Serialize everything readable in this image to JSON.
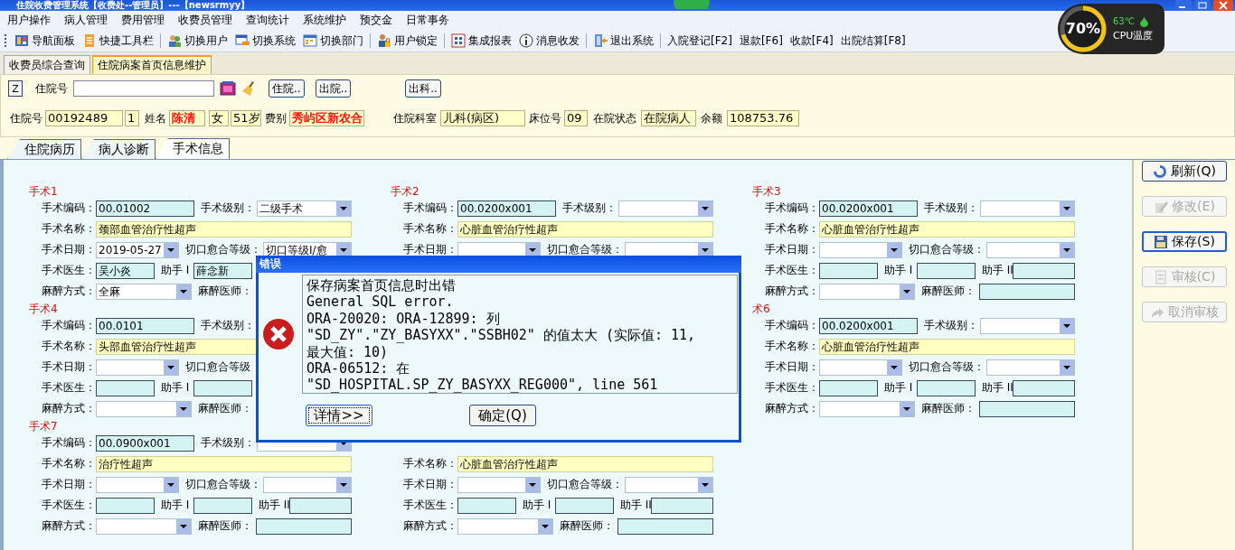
{
  "window": {
    "title": "住院收费管理系统【收费处--管理员】---【newsrmyy】"
  },
  "menu": [
    "用户操作",
    "病人管理",
    "费用管理",
    "收费员管理",
    "查询统计",
    "系统维护",
    "预交金",
    "日常事务"
  ],
  "toolbar": [
    [
      {
        "kind": "icon-button",
        "label": "导航面板"
      },
      {
        "kind": "icon-button",
        "label": "快捷工具栏"
      }
    ],
    [
      {
        "kind": "icon-button",
        "label": "切换用户"
      },
      {
        "kind": "icon-button",
        "label": "切换系统"
      },
      {
        "kind": "icon-button",
        "label": "切换部门"
      }
    ],
    [
      {
        "kind": "icon-button",
        "label": "用户锁定"
      }
    ],
    [
      {
        "kind": "icon-button",
        "label": "集成报表"
      },
      {
        "kind": "icon-button",
        "label": "消息收发"
      }
    ],
    [
      {
        "kind": "icon-button",
        "label": "退出系统"
      }
    ],
    [
      {
        "kind": "text-button",
        "label": "入院登记[F2]"
      },
      {
        "kind": "text-button",
        "label": "退款[F6]"
      },
      {
        "kind": "text-button",
        "label": "收款[F4]"
      },
      {
        "kind": "text-button",
        "label": "出院结算[F8]"
      }
    ]
  ],
  "cpu_widget": {
    "reading": "70%",
    "level": 0.7,
    "temperature": "63℃",
    "label": "CPU温度"
  },
  "tabs": [
    {
      "label": "收费员综合查询",
      "selected": false
    },
    {
      "label": "住院病案首页信息维护",
      "selected": true
    }
  ],
  "search": {
    "key_button": "Z",
    "label": "住院号",
    "buttons": [
      "住院..",
      "出院..",
      "出科.."
    ]
  },
  "patient_info": [
    {
      "kind": "label",
      "text": "住院号"
    },
    {
      "kind": "field",
      "value": "00192489"
    },
    {
      "kind": "field",
      "value": "1"
    },
    {
      "kind": "label",
      "text": "姓名"
    },
    {
      "kind": "field",
      "value": "陈清",
      "color": "#ff0000"
    },
    {
      "kind": "field",
      "value": "女"
    },
    {
      "kind": "field",
      "value": "51岁"
    },
    {
      "kind": "label",
      "text": "费别"
    },
    {
      "kind": "field",
      "value": "秀屿区新农合",
      "color": "#ff0000"
    },
    {
      "kind": "label",
      "text": "住院科室"
    },
    {
      "kind": "field",
      "value": "儿科(病区)"
    },
    {
      "kind": "label",
      "text": "床位号"
    },
    {
      "kind": "field",
      "value": "09"
    },
    {
      "kind": "label",
      "text": "在院状态"
    },
    {
      "kind": "field",
      "value": "在院病人"
    },
    {
      "kind": "label",
      "text": "余额"
    },
    {
      "kind": "field",
      "value": "108753.76"
    }
  ],
  "record_tabs": [
    {
      "label": "住院病历",
      "selected": false
    },
    {
      "label": "病人诊断",
      "selected": false
    },
    {
      "label": "手术信息",
      "selected": true
    }
  ],
  "surgeries": [
    {
      "title": "手术1",
      "rows": [
        {
          "kind": "code",
          "items": [
            {
              "kind": "label",
              "text": "手术编码："
            },
            {
              "kind": "field",
              "value": "00.01002"
            },
            {
              "kind": "label",
              "text": "手术级别："
            },
            {
              "kind": "select",
              "value": "二级手术"
            }
          ]
        },
        {
          "kind": "name",
          "items": [
            {
              "kind": "label",
              "text": "手术名称："
            },
            {
              "kind": "name-field",
              "value": "颈部血管治疗性超声"
            }
          ]
        },
        {
          "kind": "date",
          "items": [
            {
              "kind": "label",
              "text": "手术日期："
            },
            {
              "kind": "select",
              "value": "2019-05-27"
            },
            {
              "kind": "label",
              "text": "切口愈合等级："
            },
            {
              "kind": "select",
              "value": "切口等级Ⅰ/愈"
            }
          ]
        },
        {
          "kind": "staff",
          "items": [
            {
              "kind": "label",
              "text": "手术医生："
            },
            {
              "kind": "field",
              "value": "吴小炎"
            },
            {
              "kind": "label",
              "text": "助手 I"
            },
            {
              "kind": "field",
              "value": "薛念新"
            }
          ]
        },
        {
          "kind": "anesthesia",
          "items": [
            {
              "kind": "label",
              "text": "麻醉方式："
            },
            {
              "kind": "select",
              "value": "全麻"
            },
            {
              "kind": "label",
              "text": "麻醉医师："
            }
          ]
        }
      ]
    },
    {
      "title": "手术2",
      "rows": [
        {
          "kind": "code",
          "items": [
            {
              "kind": "label",
              "text": "手术编码："
            },
            {
              "kind": "field",
              "value": "00.0200x001"
            },
            {
              "kind": "label",
              "text": "手术级别："
            },
            {
              "kind": "select"
            }
          ]
        },
        {
          "kind": "name",
          "items": [
            {
              "kind": "label",
              "text": "手术名称："
            },
            {
              "kind": "name-field",
              "value": "心脏血管治疗性超声"
            }
          ]
        },
        {
          "kind": "date",
          "items": [
            {
              "kind": "label",
              "text": "手术日期："
            },
            {
              "kind": "select"
            },
            {
              "kind": "label",
              "text": "切口愈合等级："
            },
            {
              "kind": "select"
            }
          ]
        }
      ]
    },
    {
      "title": "手术3",
      "rows": [
        {
          "kind": "code",
          "items": [
            {
              "kind": "label",
              "text": "手术编码："
            },
            {
              "kind": "field",
              "value": "00.0200x001"
            },
            {
              "kind": "label",
              "text": "手术级别："
            },
            {
              "kind": "select"
            }
          ]
        },
        {
          "kind": "name",
          "items": [
            {
              "kind": "label",
              "text": "手术名称："
            },
            {
              "kind": "name-field",
              "value": "心脏血管治疗性超声"
            }
          ]
        },
        {
          "kind": "date",
          "items": [
            {
              "kind": "label",
              "text": "手术日期："
            },
            {
              "kind": "select"
            },
            {
              "kind": "label",
              "text": "切口愈合等级："
            },
            {
              "kind": "select"
            }
          ]
        },
        {
          "kind": "staff",
          "items": [
            {
              "kind": "label",
              "text": "手术医生："
            },
            {
              "kind": "field"
            },
            {
              "kind": "label",
              "text": "助手 I"
            },
            {
              "kind": "field"
            },
            {
              "kind": "label",
              "text": "助手 II"
            },
            {
              "kind": "field"
            }
          ]
        },
        {
          "kind": "anesthesia",
          "items": [
            {
              "kind": "label",
              "text": "麻醉方式："
            },
            {
              "kind": "select"
            },
            {
              "kind": "label",
              "text": "麻醉医师："
            },
            {
              "kind": "field"
            }
          ]
        }
      ]
    },
    {
      "title": "手术4",
      "rows": [
        {
          "kind": "code",
          "items": [
            {
              "kind": "label",
              "text": "手术编码："
            },
            {
              "kind": "field",
              "value": "00.0101"
            },
            {
              "kind": "label",
              "text": "手术级别："
            }
          ]
        },
        {
          "kind": "name",
          "items": [
            {
              "kind": "label",
              "text": "手术名称："
            },
            {
              "kind": "name-field",
              "value": "头部血管治疗性超声"
            }
          ]
        },
        {
          "kind": "date",
          "items": [
            {
              "kind": "label",
              "text": "手术日期："
            },
            {
              "kind": "select"
            },
            {
              "kind": "label",
              "text": "切口愈合等级"
            }
          ]
        },
        {
          "kind": "staff",
          "items": [
            {
              "kind": "label",
              "text": "手术医生："
            },
            {
              "kind": "field"
            },
            {
              "kind": "label",
              "text": "助手 I"
            },
            {
              "kind": "field"
            }
          ]
        },
        {
          "kind": "anesthesia",
          "items": [
            {
              "kind": "label",
              "text": "麻醉方式："
            },
            {
              "kind": "select"
            },
            {
              "kind": "label",
              "text": "麻醉医师："
            }
          ]
        }
      ]
    },
    {
      "title": "术6",
      "rows": [
        {
          "kind": "code",
          "items": [
            {
              "kind": "label",
              "text": "手术编码："
            },
            {
              "kind": "field",
              "value": "00.0200x001"
            },
            {
              "kind": "label",
              "text": "手术级别："
            },
            {
              "kind": "select"
            }
          ]
        },
        {
          "kind": "name",
          "items": [
            {
              "kind": "label",
              "text": "手术名称："
            },
            {
              "kind": "name-field",
              "value": "心脏血管治疗性超声"
            }
          ]
        },
        {
          "kind": "date",
          "items": [
            {
              "kind": "label",
              "text": "手术日期："
            },
            {
              "kind": "select"
            },
            {
              "kind": "label",
              "text": "切口愈合等级："
            },
            {
              "kind": "select"
            }
          ]
        },
        {
          "kind": "staff",
          "items": [
            {
              "kind": "label",
              "text": "手术医生："
            },
            {
              "kind": "field"
            },
            {
              "kind": "label",
              "text": "助手 I"
            },
            {
              "kind": "field"
            },
            {
              "kind": "label",
              "text": "助手 II"
            },
            {
              "kind": "field"
            }
          ]
        },
        {
          "kind": "anesthesia",
          "items": [
            {
              "kind": "label",
              "text": "麻醉方式："
            },
            {
              "kind": "select"
            },
            {
              "kind": "label",
              "text": "麻醉医师："
            },
            {
              "kind": "field"
            }
          ]
        }
      ]
    },
    {
      "title": "手术7",
      "rows": [
        {
          "kind": "code",
          "items": [
            {
              "kind": "label",
              "text": "手术编码："
            },
            {
              "kind": "field",
              "value": "00.0900x001"
            },
            {
              "kind": "label",
              "text": "手术级别："
            },
            {
              "kind": "select"
            }
          ]
        },
        {
          "kind": "name",
          "items": [
            {
              "kind": "label",
              "text": "手术名称："
            },
            {
              "kind": "name-field",
              "value": "治疗性超声"
            }
          ]
        },
        {
          "kind": "date",
          "items": [
            {
              "kind": "label",
              "text": "手术日期："
            },
            {
              "kind": "select"
            },
            {
              "kind": "label",
              "text": "切口愈合等级："
            },
            {
              "kind": "select"
            }
          ]
        },
        {
          "kind": "staff",
          "items": [
            {
              "kind": "label",
              "text": "手术医生："
            },
            {
              "kind": "field"
            },
            {
              "kind": "label",
              "text": "助手 I"
            },
            {
              "kind": "field"
            },
            {
              "kind": "label",
              "text": "助手 II"
            },
            {
              "kind": "field"
            }
          ]
        },
        {
          "kind": "anesthesia",
          "items": [
            {
              "kind": "label",
              "text": "麻醉方式："
            },
            {
              "kind": "select"
            },
            {
              "kind": "label",
              "text": "麻醉医师："
            },
            {
              "kind": "field"
            }
          ]
        }
      ]
    },
    {
      "rows": [
        {
          "kind": "name",
          "items": [
            {
              "kind": "label",
              "text": "手术名称："
            },
            {
              "kind": "name-field",
              "value": "心脏血管治疗性超声"
            }
          ]
        },
        {
          "kind": "date",
          "items": [
            {
              "kind": "label",
              "text": "手术日期："
            },
            {
              "kind": "select"
            },
            {
              "kind": "label",
              "text": "切口愈合等级："
            },
            {
              "kind": "select"
            }
          ]
        },
        {
          "kind": "staff",
          "items": [
            {
              "kind": "label",
              "text": "手术医生："
            },
            {
              "kind": "field"
            },
            {
              "kind": "label",
              "text": "助手 I"
            },
            {
              "kind": "field"
            },
            {
              "kind": "label",
              "text": "助手 II"
            },
            {
              "kind": "field"
            }
          ]
        },
        {
          "kind": "anesthesia",
          "items": [
            {
              "kind": "label",
              "text": "麻醉方式："
            },
            {
              "kind": "select"
            },
            {
              "kind": "label",
              "text": "麻醉医师："
            },
            {
              "kind": "field"
            }
          ]
        }
      ]
    }
  ],
  "side_buttons": [
    {
      "label": "刷新(Q)",
      "disabled": false,
      "focused": false
    },
    {
      "label": "修改(E)",
      "disabled": true,
      "focused": false
    },
    {
      "label": "保存(S)",
      "disabled": false,
      "focused": true
    },
    {
      "label": "审核(C)",
      "disabled": true,
      "focused": false
    },
    {
      "label": "取消审核",
      "disabled": true,
      "focused": false
    }
  ],
  "dialog": {
    "title": "错误",
    "lines": [
      "保存病案首页信息时出错",
      "General SQL error.",
      "ORA-20020: ORA-12899: 列",
      "\"SD_ZY\".\"ZY_BASYXX\".\"SSBH02\" 的值太大 (实际值: 11,",
      "最大值: 10)",
      "ORA-06512: 在",
      "\"SD_HOSPITAL.SP_ZY_BASYXX_REG000\", line 561"
    ],
    "buttons": [
      {
        "label": "详情>>",
        "focused": true
      },
      {
        "label": "确定(Q)",
        "focused": false
      }
    ]
  }
}
